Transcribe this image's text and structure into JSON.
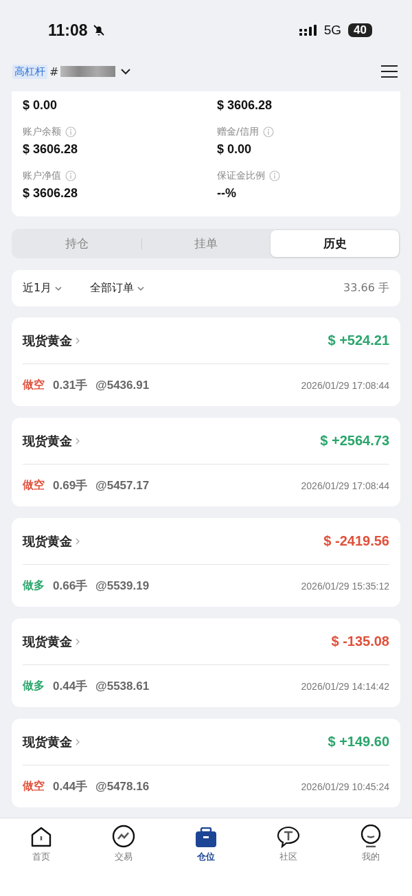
{
  "status_bar": {
    "time": "11:08",
    "network": "5G",
    "battery": "40"
  },
  "header": {
    "tag": "高杠杆",
    "account_prefix": "#"
  },
  "summary": [
    {
      "value": "$ 0.00"
    },
    {
      "value": "$ 3606.28"
    },
    {
      "label": "账户余额",
      "value": "$ 3606.28"
    },
    {
      "label": "赠金/信用",
      "value": "$ 0.00"
    },
    {
      "label": "账户净值",
      "value": "$ 3606.28"
    },
    {
      "label": "保证金比例",
      "value": "--%"
    }
  ],
  "tabs": [
    {
      "label": "持仓",
      "selected": false
    },
    {
      "label": "挂单",
      "selected": false
    },
    {
      "label": "历史",
      "selected": true
    }
  ],
  "filters": {
    "period": "近1月",
    "order_type": "全部订单",
    "total": "33.66 手"
  },
  "orders": [
    {
      "symbol": "现货黄金",
      "profit": {
        "text": "$ +524.21",
        "kind": "gain"
      },
      "side": {
        "text": "做空",
        "kind": "short"
      },
      "lots": "0.31手",
      "price": "@5436.91",
      "time": "2026/01/29 17:08:44"
    },
    {
      "symbol": "现货黄金",
      "profit": {
        "text": "$ +2564.73",
        "kind": "gain"
      },
      "side": {
        "text": "做空",
        "kind": "short"
      },
      "lots": "0.69手",
      "price": "@5457.17",
      "time": "2026/01/29 17:08:44"
    },
    {
      "symbol": "现货黄金",
      "profit": {
        "text": "$ -2419.56",
        "kind": "loss"
      },
      "side": {
        "text": "做多",
        "kind": "long"
      },
      "lots": "0.66手",
      "price": "@5539.19",
      "time": "2026/01/29 15:35:12"
    },
    {
      "symbol": "现货黄金",
      "profit": {
        "text": "$ -135.08",
        "kind": "loss"
      },
      "side": {
        "text": "做多",
        "kind": "long"
      },
      "lots": "0.44手",
      "price": "@5538.61",
      "time": "2026/01/29 14:14:42"
    },
    {
      "symbol": "现货黄金",
      "profit": {
        "text": "$ +149.60",
        "kind": "gain"
      },
      "side": {
        "text": "做空",
        "kind": "short"
      },
      "lots": "0.44手",
      "price": "@5478.16",
      "time": "2026/01/29 10:45:24"
    }
  ],
  "nav": [
    {
      "label": "首页",
      "kind": "home",
      "selected": false
    },
    {
      "label": "交易",
      "kind": "trade",
      "selected": false
    },
    {
      "label": "仓位",
      "kind": "positions",
      "selected": true
    },
    {
      "label": "社区",
      "kind": "community",
      "selected": false
    },
    {
      "label": "我的",
      "kind": "me",
      "selected": false
    }
  ]
}
